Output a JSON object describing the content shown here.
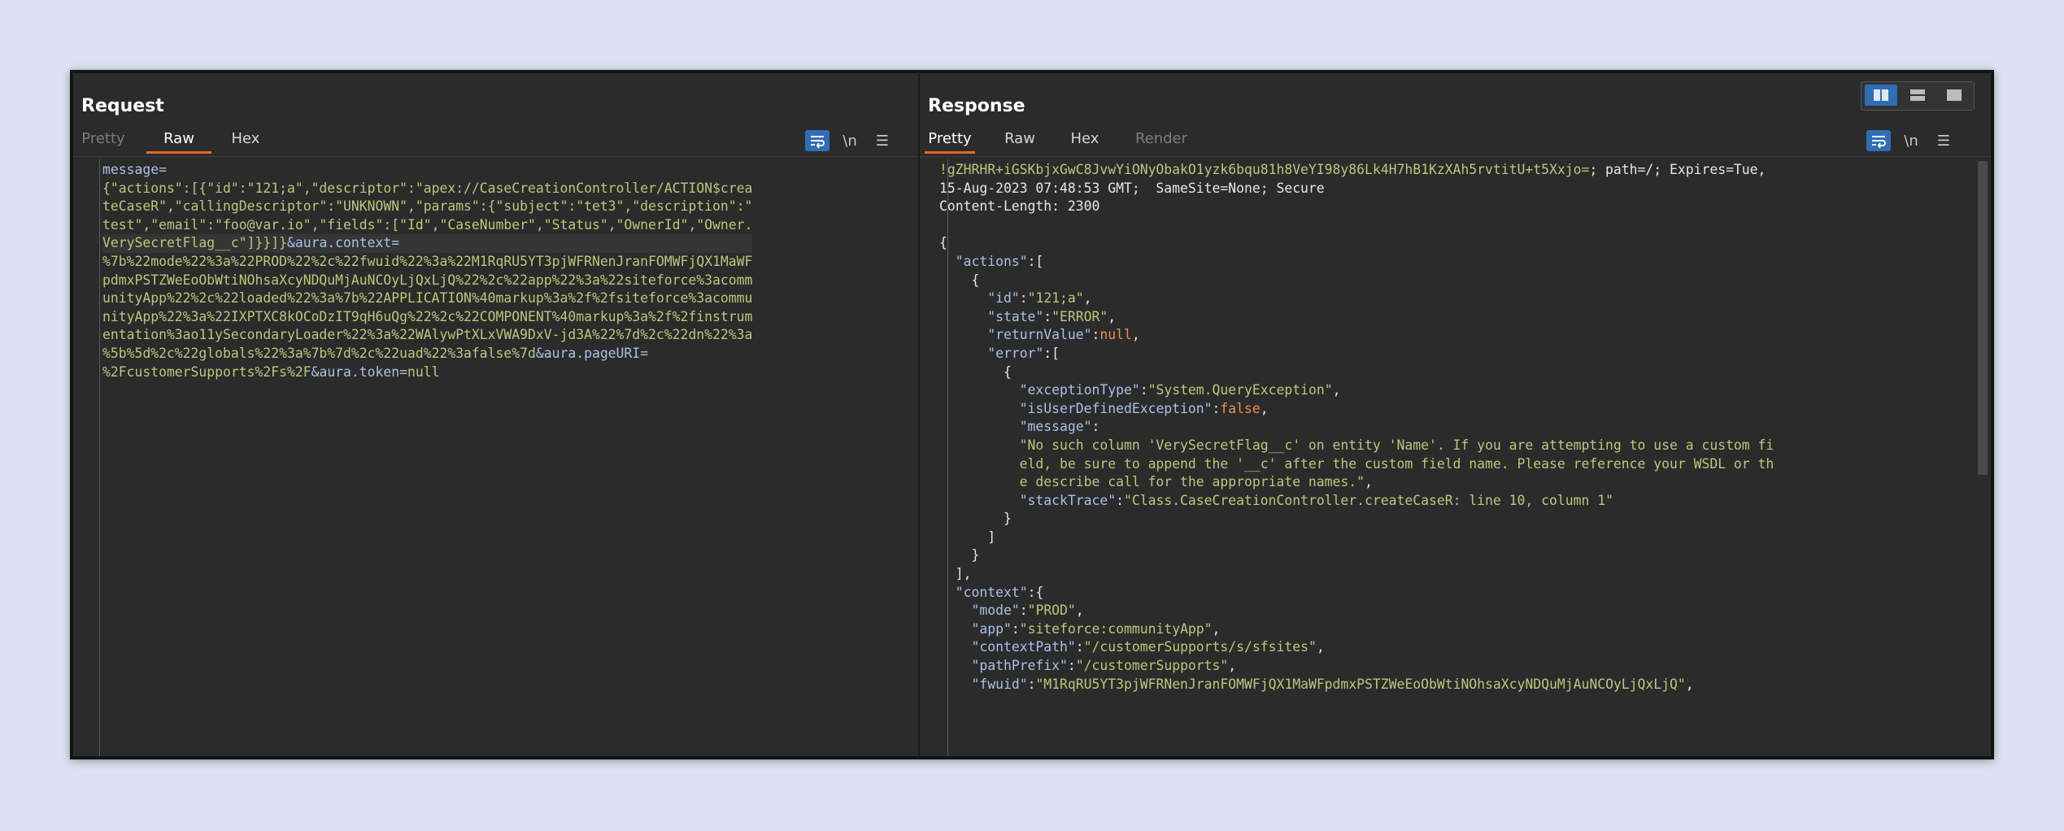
{
  "request": {
    "title": "Request",
    "tabs": [
      "Pretty",
      "Raw",
      "Hex"
    ],
    "active_tab": "Raw",
    "tools": {
      "wrap": "wrap-icon",
      "newline": "\\n",
      "menu": "☰"
    },
    "lines": [
      [
        {
          "t": "message=",
          "c": "p"
        }
      ],
      [
        {
          "t": "{\"actions\":[{\"id\":\"121;a\",\"descriptor\":\"apex://CaseCreationController/ACTION$crea",
          "c": "k"
        }
      ],
      [
        {
          "t": "teCaseR\",\"callingDescriptor\":\"UNKNOWN\",\"params\":{\"subject\":\"tet3\",\"description\":\"",
          "c": "k"
        }
      ],
      [
        {
          "t": "test\",\"email\":\"foo@var.io\",\"fields\":[\"Id\",\"CaseNumber\",\"Status\",\"OwnerId\",\"Owner.",
          "c": "k"
        }
      ],
      [
        {
          "t": "VerySecretFlag__c\"]}}]}",
          "c": "k"
        },
        {
          "t": "&aura.context=",
          "c": "p"
        }
      ],
      [
        {
          "t": "%7b%22mode%22%3a%22PROD%22%2c%22fwuid%22%3a%22M1RqRU5YT3pjWFRNenJranFOMWFjQX1MaWF",
          "c": "k"
        }
      ],
      [
        {
          "t": "pdmxPSTZWeEoObWtiNOhsaXcyNDQuMjAuNCOyLjQxLjQ%22%2c%22app%22%3a%22siteforce%3acomm",
          "c": "k"
        }
      ],
      [
        {
          "t": "unityApp%22%2c%22loaded%22%3a%7b%22APPLICATION%40markup%3a%2f%2fsiteforce%3acommu",
          "c": "k"
        }
      ],
      [
        {
          "t": "nityApp%22%3a%22IXPTXC8kOCoDzIT9qH6uQg%22%2c%22COMPONENT%40markup%3a%2f%2finstrum",
          "c": "k"
        }
      ],
      [
        {
          "t": "entation%3ao11ySecondaryLoader%22%3a%22WAlywPtXLxVWA9DxV-jd3A%22%7d%2c%22dn%22%3a",
          "c": "k"
        }
      ],
      [
        {
          "t": "%5b%5d%2c%22globals%22%3a%7b%7d%2c%22uad%22%3afalse%7d",
          "c": "k"
        },
        {
          "t": "&aura.pageURI=",
          "c": "p"
        }
      ],
      [
        {
          "t": "%2FcustomerSupports%2Fs%2F",
          "c": "k"
        },
        {
          "t": "&aura.token=",
          "c": "p"
        },
        {
          "t": "null",
          "c": "k"
        }
      ]
    ]
  },
  "response": {
    "title": "Response",
    "tabs": [
      "Pretty",
      "Raw",
      "Hex",
      "Render"
    ],
    "active_tab": "Pretty",
    "tools": {
      "wrap": "wrap-icon",
      "newline": "\\n",
      "menu": "☰"
    },
    "layout_buttons": [
      "split-horizontal-icon",
      "split-vertical-icon",
      "single-pane-icon"
    ],
    "lines": [
      [
        {
          "t": "!gZHRHR+iGSKbjxGwC8JvwYiONyObakO1yzk6bqu81h8VeYI98y86Lk4H7hB1KzXAh5rvtitU+t5Xxjo=",
          "c": "k"
        },
        {
          "t": "; path=/; Expires=Tue,",
          "c": "w"
        }
      ],
      [
        {
          "t": "15-Aug-2023 07:48:53 GMT;  SameSite=None; Secure",
          "c": "w"
        }
      ],
      [
        {
          "t": "Content-Length: 2300",
          "c": "w"
        }
      ],
      [
        {
          "t": "",
          "c": "w"
        }
      ],
      [
        {
          "t": "{",
          "c": "w"
        }
      ],
      [
        {
          "t": "  ",
          "c": "w"
        },
        {
          "t": "\"actions\"",
          "c": "p"
        },
        {
          "t": ":[",
          "c": "w"
        }
      ],
      [
        {
          "t": "    {",
          "c": "w"
        }
      ],
      [
        {
          "t": "      ",
          "c": "w"
        },
        {
          "t": "\"id\"",
          "c": "p"
        },
        {
          "t": ":",
          "c": "w"
        },
        {
          "t": "\"121;a\"",
          "c": "k"
        },
        {
          "t": ",",
          "c": "w"
        }
      ],
      [
        {
          "t": "      ",
          "c": "w"
        },
        {
          "t": "\"state\"",
          "c": "p"
        },
        {
          "t": ":",
          "c": "w"
        },
        {
          "t": "\"ERROR\"",
          "c": "k"
        },
        {
          "t": ",",
          "c": "w"
        }
      ],
      [
        {
          "t": "      ",
          "c": "w"
        },
        {
          "t": "\"returnValue\"",
          "c": "p"
        },
        {
          "t": ":",
          "c": "w"
        },
        {
          "t": "null",
          "c": "o"
        },
        {
          "t": ",",
          "c": "w"
        }
      ],
      [
        {
          "t": "      ",
          "c": "w"
        },
        {
          "t": "\"error\"",
          "c": "p"
        },
        {
          "t": ":[",
          "c": "w"
        }
      ],
      [
        {
          "t": "        {",
          "c": "w"
        }
      ],
      [
        {
          "t": "          ",
          "c": "w"
        },
        {
          "t": "\"exceptionType\"",
          "c": "p"
        },
        {
          "t": ":",
          "c": "w"
        },
        {
          "t": "\"System.QueryException\"",
          "c": "k"
        },
        {
          "t": ",",
          "c": "w"
        }
      ],
      [
        {
          "t": "          ",
          "c": "w"
        },
        {
          "t": "\"isUserDefinedException\"",
          "c": "p"
        },
        {
          "t": ":",
          "c": "w"
        },
        {
          "t": "false",
          "c": "o"
        },
        {
          "t": ",",
          "c": "w"
        }
      ],
      [
        {
          "t": "          ",
          "c": "w"
        },
        {
          "t": "\"message\"",
          "c": "p"
        },
        {
          "t": ":",
          "c": "w"
        }
      ],
      [
        {
          "t": "          \"No such column 'VerySecretFlag__c' on entity 'Name'. If you are attempting to use a custom fi",
          "c": "k"
        }
      ],
      [
        {
          "t": "          eld, be sure to append the '__c' after the custom field name. Please reference your WSDL or th",
          "c": "k"
        }
      ],
      [
        {
          "t": "          e describe call for the appropriate names.\"",
          "c": "k"
        },
        {
          "t": ",",
          "c": "w"
        }
      ],
      [
        {
          "t": "          ",
          "c": "w"
        },
        {
          "t": "\"stackTrace\"",
          "c": "p"
        },
        {
          "t": ":",
          "c": "w"
        },
        {
          "t": "\"Class.CaseCreationController.createCaseR: line 10, column 1\"",
          "c": "k"
        }
      ],
      [
        {
          "t": "        }",
          "c": "w"
        }
      ],
      [
        {
          "t": "      ]",
          "c": "w"
        }
      ],
      [
        {
          "t": "    }",
          "c": "w"
        }
      ],
      [
        {
          "t": "  ],",
          "c": "w"
        }
      ],
      [
        {
          "t": "  ",
          "c": "w"
        },
        {
          "t": "\"context\"",
          "c": "p"
        },
        {
          "t": ":{",
          "c": "w"
        }
      ],
      [
        {
          "t": "    ",
          "c": "w"
        },
        {
          "t": "\"mode\"",
          "c": "p"
        },
        {
          "t": ":",
          "c": "w"
        },
        {
          "t": "\"PROD\"",
          "c": "k"
        },
        {
          "t": ",",
          "c": "w"
        }
      ],
      [
        {
          "t": "    ",
          "c": "w"
        },
        {
          "t": "\"app\"",
          "c": "p"
        },
        {
          "t": ":",
          "c": "w"
        },
        {
          "t": "\"siteforce:communityApp\"",
          "c": "k"
        },
        {
          "t": ",",
          "c": "w"
        }
      ],
      [
        {
          "t": "    ",
          "c": "w"
        },
        {
          "t": "\"contextPath\"",
          "c": "p"
        },
        {
          "t": ":",
          "c": "w"
        },
        {
          "t": "\"/customerSupports/s/sfsites\"",
          "c": "k"
        },
        {
          "t": ",",
          "c": "w"
        }
      ],
      [
        {
          "t": "    ",
          "c": "w"
        },
        {
          "t": "\"pathPrefix\"",
          "c": "p"
        },
        {
          "t": ":",
          "c": "w"
        },
        {
          "t": "\"/customerSupports\"",
          "c": "k"
        },
        {
          "t": ",",
          "c": "w"
        }
      ],
      [
        {
          "t": "    ",
          "c": "w"
        },
        {
          "t": "\"fwuid\"",
          "c": "p"
        },
        {
          "t": ":",
          "c": "w"
        },
        {
          "t": "\"M1RqRU5YT3pjWFRNenJranFOMWFjQX1MaWFpdmxPSTZWeEoObWtiNOhsaXcyNDQuMjAuNCOyLjQxLjQ\"",
          "c": "k"
        },
        {
          "t": ",",
          "c": "w"
        }
      ]
    ]
  }
}
